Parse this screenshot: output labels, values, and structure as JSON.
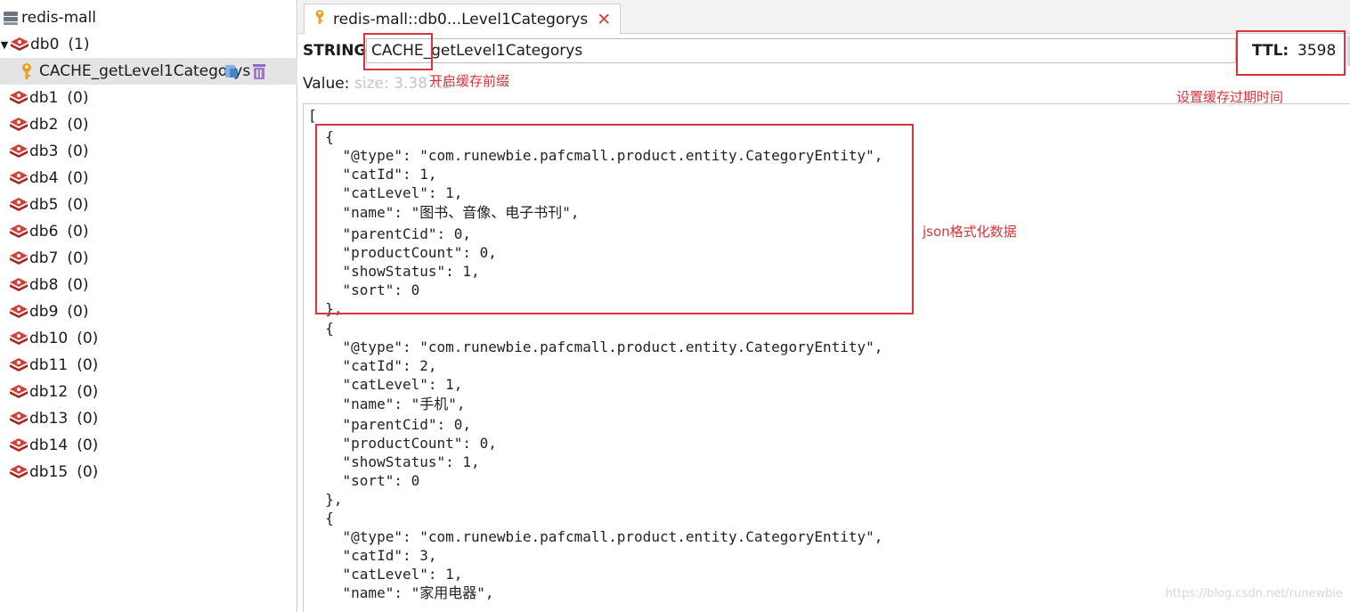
{
  "sidebar": {
    "connection": "redis-mall",
    "db0": {
      "label": "db0",
      "count": "(1)"
    },
    "key_item": "CACHE_getLevel1Categorys",
    "databases": [
      {
        "label": "db1",
        "count": "(0)"
      },
      {
        "label": "db2",
        "count": "(0)"
      },
      {
        "label": "db3",
        "count": "(0)"
      },
      {
        "label": "db4",
        "count": "(0)"
      },
      {
        "label": "db5",
        "count": "(0)"
      },
      {
        "label": "db6",
        "count": "(0)"
      },
      {
        "label": "db7",
        "count": "(0)"
      },
      {
        "label": "db8",
        "count": "(0)"
      },
      {
        "label": "db9",
        "count": "(0)"
      },
      {
        "label": "db10",
        "count": "(0)"
      },
      {
        "label": "db11",
        "count": "(0)"
      },
      {
        "label": "db12",
        "count": "(0)"
      },
      {
        "label": "db13",
        "count": "(0)"
      },
      {
        "label": "db14",
        "count": "(0)"
      },
      {
        "label": "db15",
        "count": "(0)"
      }
    ]
  },
  "tab": {
    "label": "redis-mall::db0...Level1Categorys",
    "close": "✕"
  },
  "key": {
    "type_label": "STRING:",
    "name": "CACHE_getLevel1Categorys",
    "ttl_label": "TTL:",
    "ttl_value": "3598",
    "value_label": "Value:",
    "size": "size: 3.38 KB"
  },
  "value_lines": [
    "[",
    "  {",
    "    \"@type\": \"com.runewbie.pafcmall.product.entity.CategoryEntity\",",
    "    \"catId\": 1,",
    "    \"catLevel\": 1,",
    "    \"name\": \"图书、音像、电子书刊\",",
    "    \"parentCid\": 0,",
    "    \"productCount\": 0,",
    "    \"showStatus\": 1,",
    "    \"sort\": 0",
    "  },",
    "  {",
    "    \"@type\": \"com.runewbie.pafcmall.product.entity.CategoryEntity\",",
    "    \"catId\": 2,",
    "    \"catLevel\": 1,",
    "    \"name\": \"手机\",",
    "    \"parentCid\": 0,",
    "    \"productCount\": 0,",
    "    \"showStatus\": 1,",
    "    \"sort\": 0",
    "  },",
    "  {",
    "    \"@type\": \"com.runewbie.pafcmall.product.entity.CategoryEntity\",",
    "    \"catId\": 3,",
    "    \"catLevel\": 1,",
    "    \"name\": \"家用电器\","
  ],
  "annotations": {
    "prefix": "开启缓存前缀",
    "ttl": "设置缓存过期时间",
    "json": "json格式化数据"
  },
  "watermark": "https://blog.csdn.net/runewbie",
  "colors": {
    "annotation": "#d9343a",
    "redis_icon": "#c9302c",
    "key_icon": "#e8a020"
  }
}
